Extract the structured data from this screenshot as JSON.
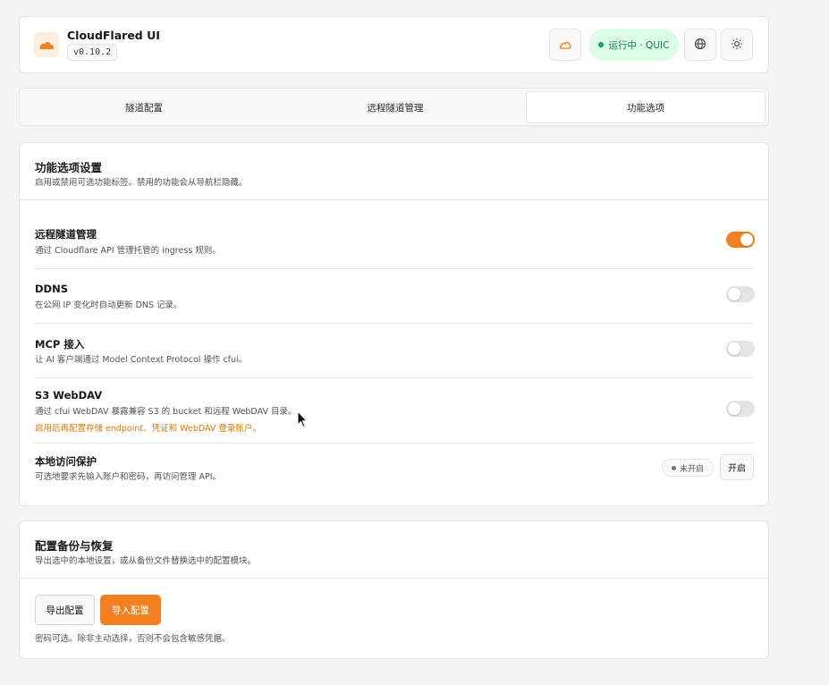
{
  "header": {
    "app_title": "CloudFlared UI",
    "version": "v0.10.2",
    "status_label": "运行中 · QUIC",
    "icons": [
      "cloud-icon",
      "globe-icon",
      "sun-icon"
    ]
  },
  "tabs": [
    {
      "label": "隧道配置",
      "active": false
    },
    {
      "label": "远程隧道管理",
      "active": false
    },
    {
      "label": "功能选项",
      "active": true
    }
  ],
  "features": {
    "title": "功能选项设置",
    "description": "启用或禁用可选功能标签。禁用的功能会从导航栏隐藏。",
    "items": [
      {
        "title": "远程隧道管理",
        "description": "通过 Cloudflare API 管理托管的 ingress 规则。",
        "enabled": true
      },
      {
        "title": "DDNS",
        "description": "在公网 IP 变化时自动更新 DNS 记录。",
        "enabled": false
      },
      {
        "title": "MCP 接入",
        "description": "让 AI 客户端通过 Model Context Protocol 操作 cfui。",
        "enabled": false
      },
      {
        "title": "S3 WebDAV",
        "description": "通过 cfui WebDAV 暴露兼容 S3 的 bucket 和远程 WebDAV 目录。",
        "warning": "启用后再配置存储 endpoint、凭证和 WebDAV 登录账户。",
        "enabled": false
      }
    ],
    "local_protection": {
      "title": "本地访问保护",
      "description": "可选地要求先输入账户和密码，再访问管理 API。",
      "status": "未开启",
      "button": "开启"
    }
  },
  "backup": {
    "title": "配置备份与恢复",
    "description": "导出选中的本地设置，或从备份文件替换选中的配置模块。",
    "export_label": "导出配置",
    "import_label": "导入配置",
    "note": "密码可选。除非主动选择，否则不会包含敏感凭据。"
  },
  "colors": {
    "accent": "#f38020",
    "success_bg": "#dcfce7",
    "success_text": "#15803d",
    "warning_text": "#d97706"
  }
}
